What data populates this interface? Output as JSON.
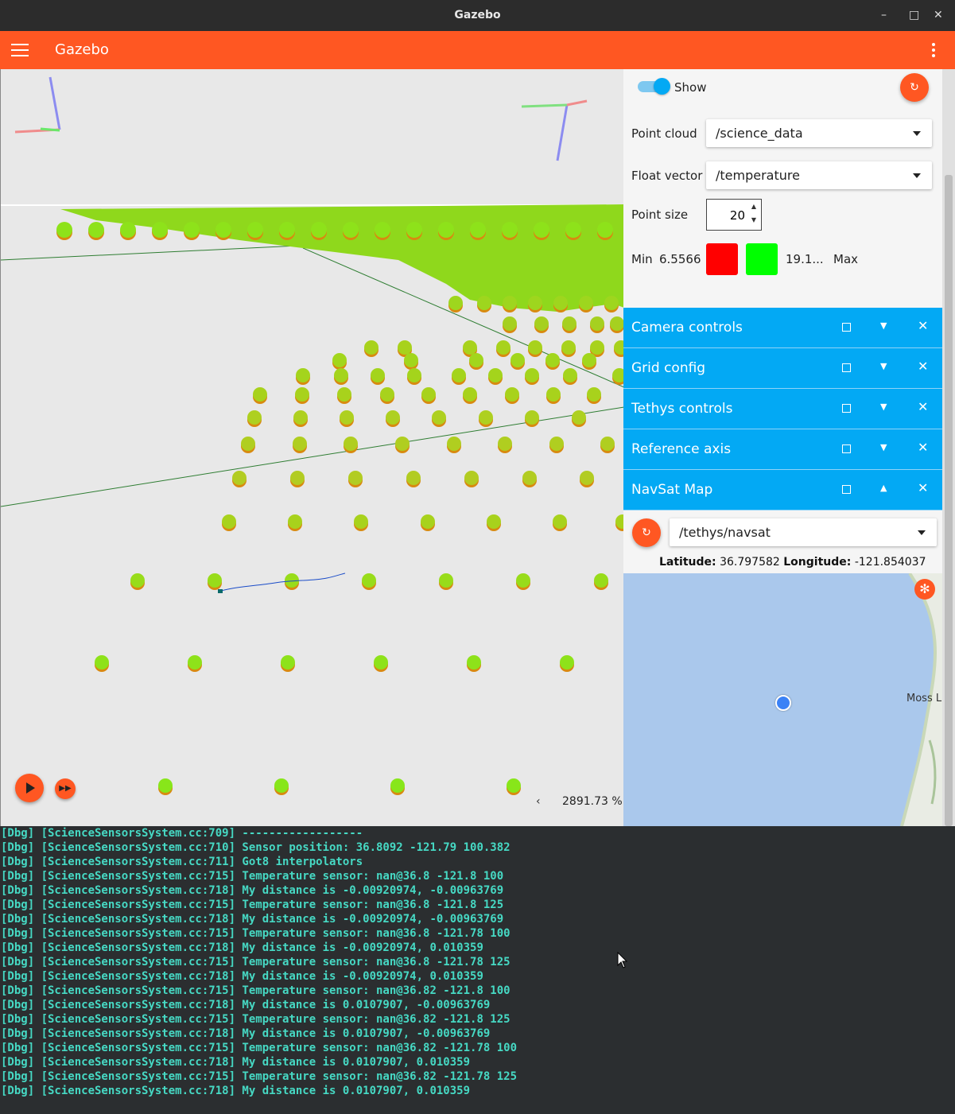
{
  "window": {
    "title": "Gazebo",
    "minimize_glyph": "–",
    "maximize_glyph": "□",
    "close_glyph": "✕"
  },
  "appbar": {
    "title": "Gazebo",
    "menu_icon": "hamburger-menu-icon",
    "overflow_icon": "kebab-menu-icon"
  },
  "viewport": {
    "playback": {
      "play_icon": "play-icon",
      "step_icon": "fast-forward-icon"
    },
    "rtf_prev": "‹",
    "rtf": "2891.73 %"
  },
  "point_cloud_panel": {
    "show_label": "Show",
    "show_enabled": true,
    "refresh_icon": "↻",
    "point_cloud_label": "Point cloud",
    "point_cloud_value": "/science_data",
    "float_vector_label": "Float vector",
    "float_vector_value": "/temperature",
    "point_size_label": "Point size",
    "point_size_value": "20",
    "min_label": "Min",
    "min_value": "6.5566",
    "min_color": "#ff0000",
    "max_color": "#00ff00",
    "max_value": "19.1...",
    "max_label": "Max"
  },
  "sections": [
    {
      "title": "Camera controls",
      "chevron": "▼",
      "close": "✕"
    },
    {
      "title": "Grid config",
      "chevron": "▼",
      "close": "✕"
    },
    {
      "title": "Tethys controls",
      "chevron": "▼",
      "close": "✕"
    },
    {
      "title": "Reference axis",
      "chevron": "▼",
      "close": "✕"
    },
    {
      "title": "NavSat Map",
      "chevron": "▲",
      "close": "✕"
    }
  ],
  "navsat": {
    "refresh_icon": "↻",
    "topic": "/tethys/navsat",
    "latitude_label": "Latitude:",
    "latitude_value": "36.797582",
    "longitude_label": "Longitude:",
    "longitude_value": "-121.854037",
    "map_label": "Moss L",
    "map_tool_icon": "✻",
    "water_color": "#aac8ec"
  },
  "terminal": {
    "lines": [
      "[Dbg] [ScienceSensorsSystem.cc:709] ------------------",
      "[Dbg] [ScienceSensorsSystem.cc:710] Sensor position: 36.8092 -121.79 100.382",
      "[Dbg] [ScienceSensorsSystem.cc:711] Got8 interpolators",
      "[Dbg] [ScienceSensorsSystem.cc:715] Temperature sensor: nan@36.8 -121.8 100",
      "[Dbg] [ScienceSensorsSystem.cc:718] My distance is -0.00920974, -0.00963769",
      "[Dbg] [ScienceSensorsSystem.cc:715] Temperature sensor: nan@36.8 -121.8 125",
      "[Dbg] [ScienceSensorsSystem.cc:718] My distance is -0.00920974, -0.00963769",
      "[Dbg] [ScienceSensorsSystem.cc:715] Temperature sensor: nan@36.8 -121.78 100",
      "[Dbg] [ScienceSensorsSystem.cc:718] My distance is -0.00920974, 0.010359",
      "[Dbg] [ScienceSensorsSystem.cc:715] Temperature sensor: nan@36.8 -121.78 125",
      "[Dbg] [ScienceSensorsSystem.cc:718] My distance is -0.00920974, 0.010359",
      "[Dbg] [ScienceSensorsSystem.cc:715] Temperature sensor: nan@36.82 -121.8 100",
      "[Dbg] [ScienceSensorsSystem.cc:718] My distance is 0.0107907, -0.00963769",
      "[Dbg] [ScienceSensorsSystem.cc:715] Temperature sensor: nan@36.82 -121.8 125",
      "[Dbg] [ScienceSensorsSystem.cc:718] My distance is 0.0107907, -0.00963769",
      "[Dbg] [ScienceSensorsSystem.cc:715] Temperature sensor: nan@36.82 -121.78 100",
      "[Dbg] [ScienceSensorsSystem.cc:718] My distance is 0.0107907, 0.010359",
      "[Dbg] [ScienceSensorsSystem.cc:715] Temperature sensor: nan@36.82 -121.78 125",
      "[Dbg] [ScienceSensorsSystem.cc:718] My distance is 0.0107907, 0.010359"
    ]
  }
}
